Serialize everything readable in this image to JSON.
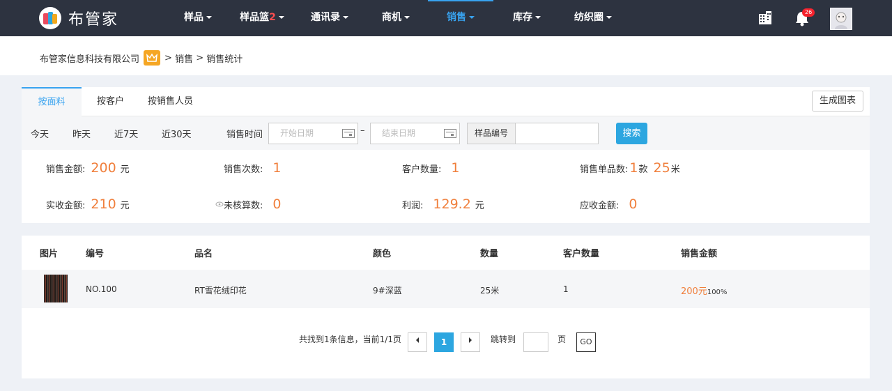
{
  "brand": {
    "name": "布管家"
  },
  "nav": {
    "items": [
      {
        "label": "样品"
      },
      {
        "label": "样品篮",
        "count": "2"
      },
      {
        "label": "通讯录"
      },
      {
        "label": "商机"
      },
      {
        "label": "销售"
      },
      {
        "label": "库存"
      },
      {
        "label": "纺织圈"
      }
    ],
    "notification_count": "26"
  },
  "breadcrumb": {
    "company": "布管家信息科技有限公司",
    "sep1": ">",
    "level1": "销售",
    "sep2": ">",
    "level2": "销售统计"
  },
  "tabs": [
    "按面料",
    "按客户",
    "按销售人员"
  ],
  "generate_chart_label": "生成图表",
  "filter": {
    "quick": [
      "今天",
      "昨天",
      "近7天",
      "近30天"
    ],
    "time_label": "销售时间",
    "start_placeholder": "开始日期",
    "end_placeholder": "结束日期",
    "range_sep": "–",
    "sample_label": "样品编号",
    "search_label": "搜索"
  },
  "stats": {
    "sales_amount": {
      "label": "销售金额:",
      "value": "200",
      "unit": "元"
    },
    "sales_count": {
      "label": "销售次数:",
      "value": "1"
    },
    "customer_count": {
      "label": "客户数量:",
      "value": "1"
    },
    "sales_items": {
      "label": "销售单品数:",
      "value1": "1",
      "unit1": "款",
      "value2": "25",
      "unit2": "米"
    },
    "received": {
      "label": "实收金额:",
      "value": "210",
      "unit": "元"
    },
    "unchecked": {
      "label": "未核算数:",
      "value": "0"
    },
    "profit": {
      "label": "利润:",
      "value": "129.2",
      "unit": "元"
    },
    "receivable": {
      "label": "应收金额:",
      "value": "0"
    }
  },
  "table": {
    "headers": [
      "图片",
      "编号",
      "品名",
      "颜色",
      "数量",
      "客户数量",
      "销售金额"
    ],
    "rows": [
      {
        "code": "NO.100",
        "name": "RT雪花绒印花",
        "color": "9#深蓝",
        "qty": "25米",
        "customers": "1",
        "amount": "200元",
        "percent": "100%"
      }
    ]
  },
  "pagination": {
    "summary": "共找到1条信息，当前1/1页",
    "current": "1",
    "jump_label": "跳转到",
    "page_unit": "页",
    "go_label": "GO"
  },
  "colors": {
    "nav_bg": "#2d3340",
    "accent": "#38a3f0",
    "value": "#f07f3c"
  }
}
